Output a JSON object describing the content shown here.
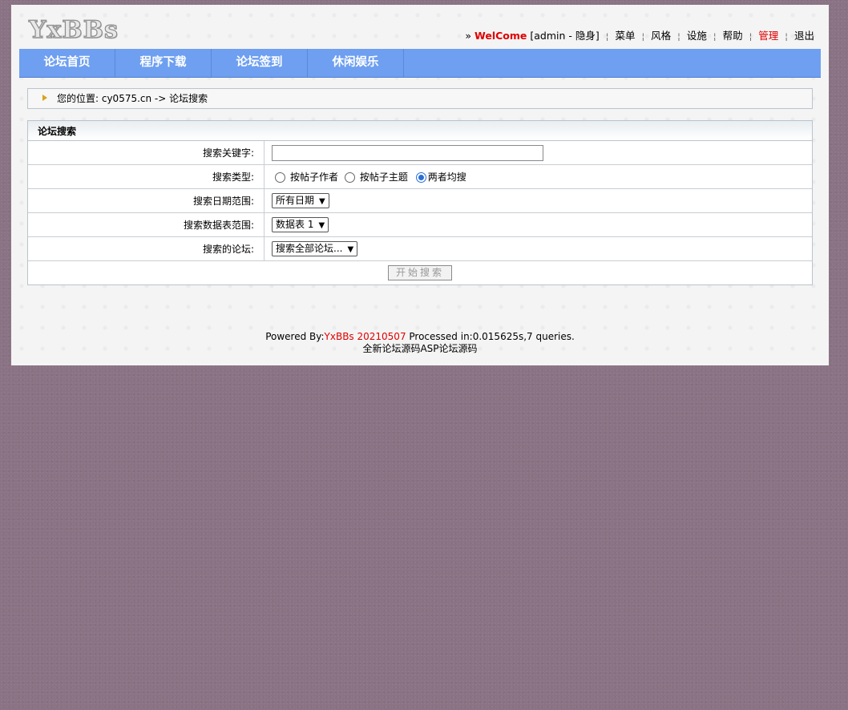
{
  "header": {
    "logo_text": "YxBBs",
    "prefix": "»",
    "welcome": "WelCome",
    "user_info": "[admin - 隐身]",
    "sep": "¦",
    "links": [
      "菜单",
      "风格",
      "设施",
      "帮助",
      "管理",
      "退出"
    ]
  },
  "nav": {
    "items": [
      "论坛首页",
      "程序下载",
      "论坛签到",
      "休闲娱乐"
    ]
  },
  "breadcrumb": {
    "text": "您的位置: cy0575.cn -> 论坛搜索"
  },
  "search": {
    "title": "论坛搜索",
    "keyword_label": "搜索关键字:",
    "keyword_value": "",
    "type_label": "搜索类型:",
    "type_options": [
      "按帖子作者",
      "按帖子主题",
      "两者均搜"
    ],
    "type_selected": "两者均搜",
    "date_label": "搜索日期范围:",
    "date_value": "所有日期",
    "table_label": "搜索数据表范围:",
    "table_value": "数据表 1",
    "forum_label": "搜索的论坛:",
    "forum_value": "搜索全部论坛...",
    "submit_label": "开始搜索"
  },
  "footer": {
    "powered_prefix": "Powered By:",
    "powered_brand": "YxBBs 20210507",
    "processed": " Processed in:0.015625s,7 queries.",
    "line2": "全新论坛源码ASP论坛源码"
  },
  "colors": {
    "accent_red": "#e00000",
    "nav_blue": "#6e9ff0",
    "page_bg": "#8a7384"
  }
}
